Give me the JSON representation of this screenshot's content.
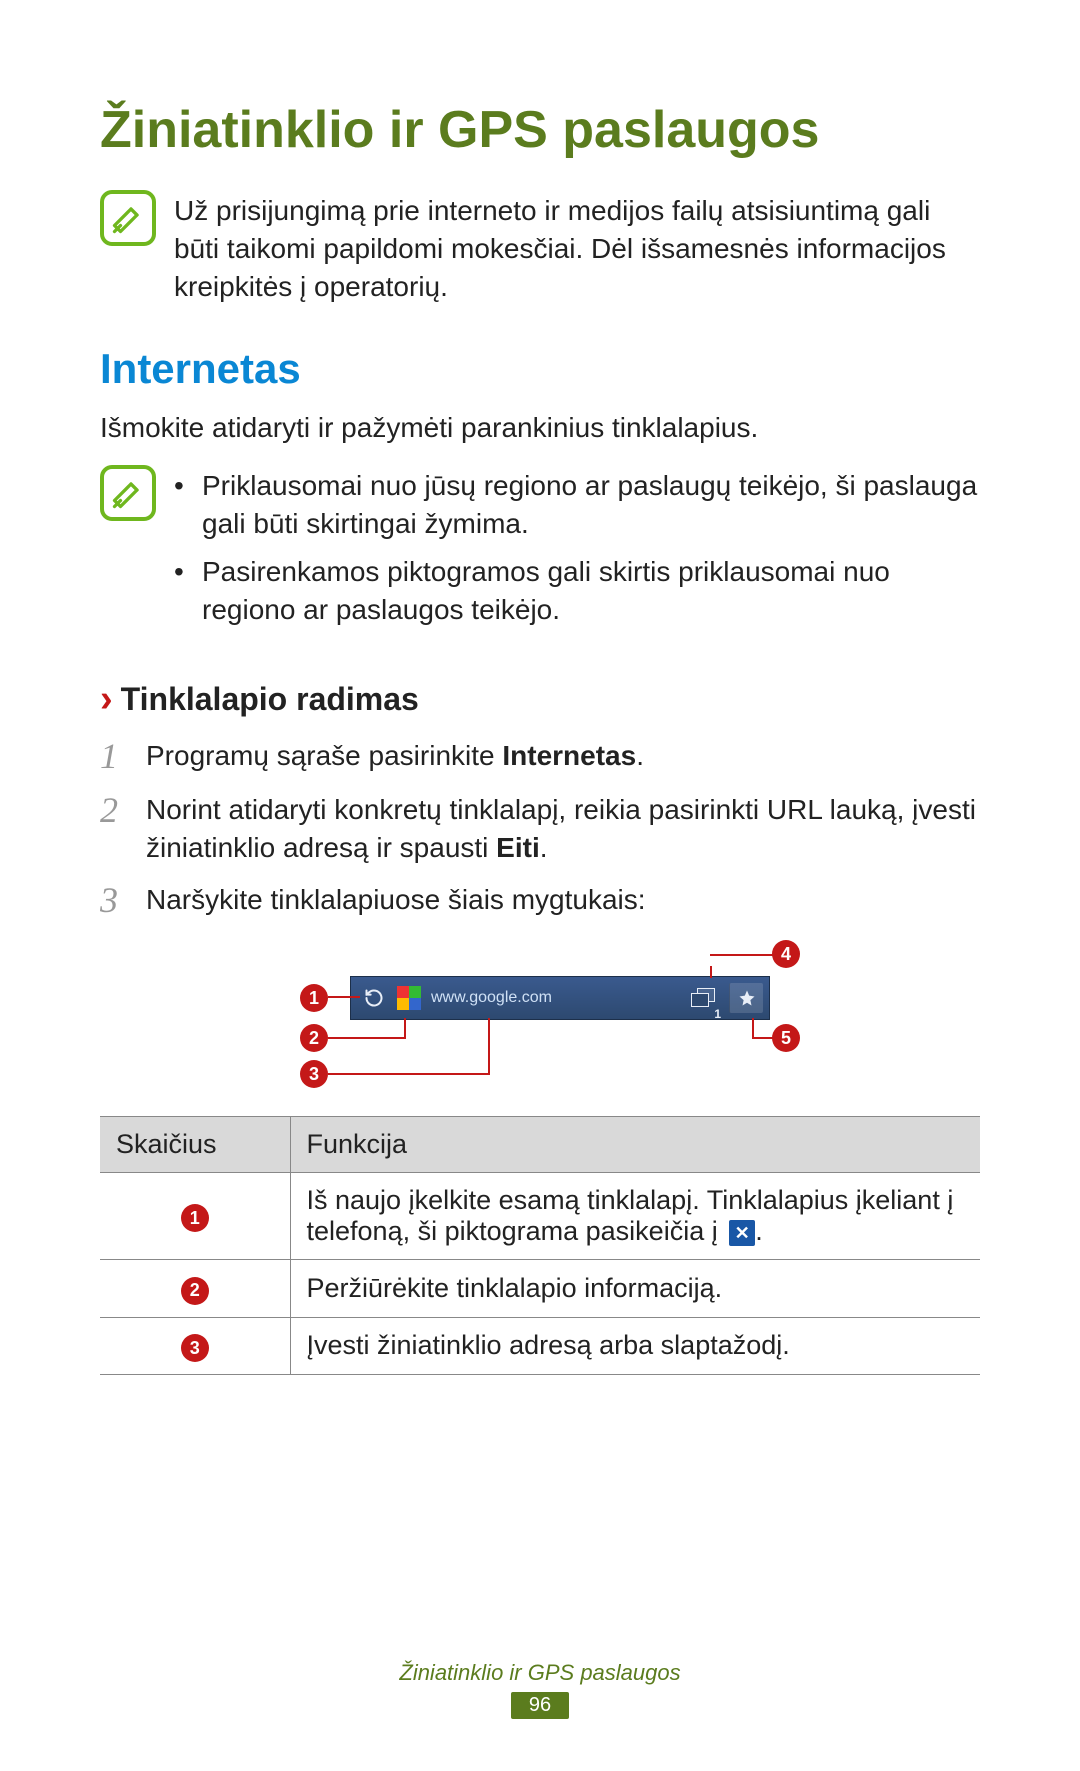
{
  "title": "Žiniatinklio ir GPS paslaugos",
  "top_note": "Už prisijungimą prie interneto ir medijos failų atsisiuntimą gali būti taikomi papildomi mokesčiai. Dėl išsamesnės informacijos kreipkitės į operatorių.",
  "section": {
    "heading": "Internetas",
    "intro": "Išmokite atidaryti ir pažymėti parankinius tinklalapius.",
    "bullets": [
      "Priklausomai nuo jūsų regiono ar paslaugų teikėjo, ši paslauga gali būti skirtingai žymima.",
      "Pasirenkamos piktogramos gali skirtis priklausomai nuo regiono ar paslaugos teikėjo."
    ]
  },
  "subsection": {
    "chevron": "›",
    "heading": "Tinklalapio radimas"
  },
  "steps": [
    {
      "num": "1",
      "pre": "Programų sąraše pasirinkite ",
      "bold": "Internetas",
      "post": "."
    },
    {
      "num": "2",
      "pre": "Norint atidaryti konkretų tinklalapį, reikia pasirinkti URL lauką, įvesti žiniatinklio adresą ir spausti ",
      "bold": "Eiti",
      "post": "."
    },
    {
      "num": "3",
      "pre": "Naršykite tinklalapiuose šiais mygtukais:",
      "bold": "",
      "post": ""
    }
  ],
  "browser_bar": {
    "url": "www.google.com",
    "windows_badge": "1",
    "callouts": {
      "c1": "1",
      "c2": "2",
      "c3": "3",
      "c4": "4",
      "c5": "5"
    }
  },
  "table": {
    "head_num": "Skaičius",
    "head_func": "Funkcija",
    "rows": [
      {
        "n": "1",
        "text_pre": "Iš naujo įkelkite esamą tinklalapį. Tinklalapius įkeliant į telefoną, ši piktograma pasikeičia į ",
        "icon": "✕",
        "text_post": "."
      },
      {
        "n": "2",
        "text_pre": "Peržiūrėkite tinklalapio informaciją.",
        "icon": "",
        "text_post": ""
      },
      {
        "n": "3",
        "text_pre": "Įvesti žiniatinklio adresą arba slaptažodį.",
        "icon": "",
        "text_post": ""
      }
    ]
  },
  "footer": {
    "title": "Žiniatinklio ir GPS paslaugos",
    "page": "96"
  }
}
